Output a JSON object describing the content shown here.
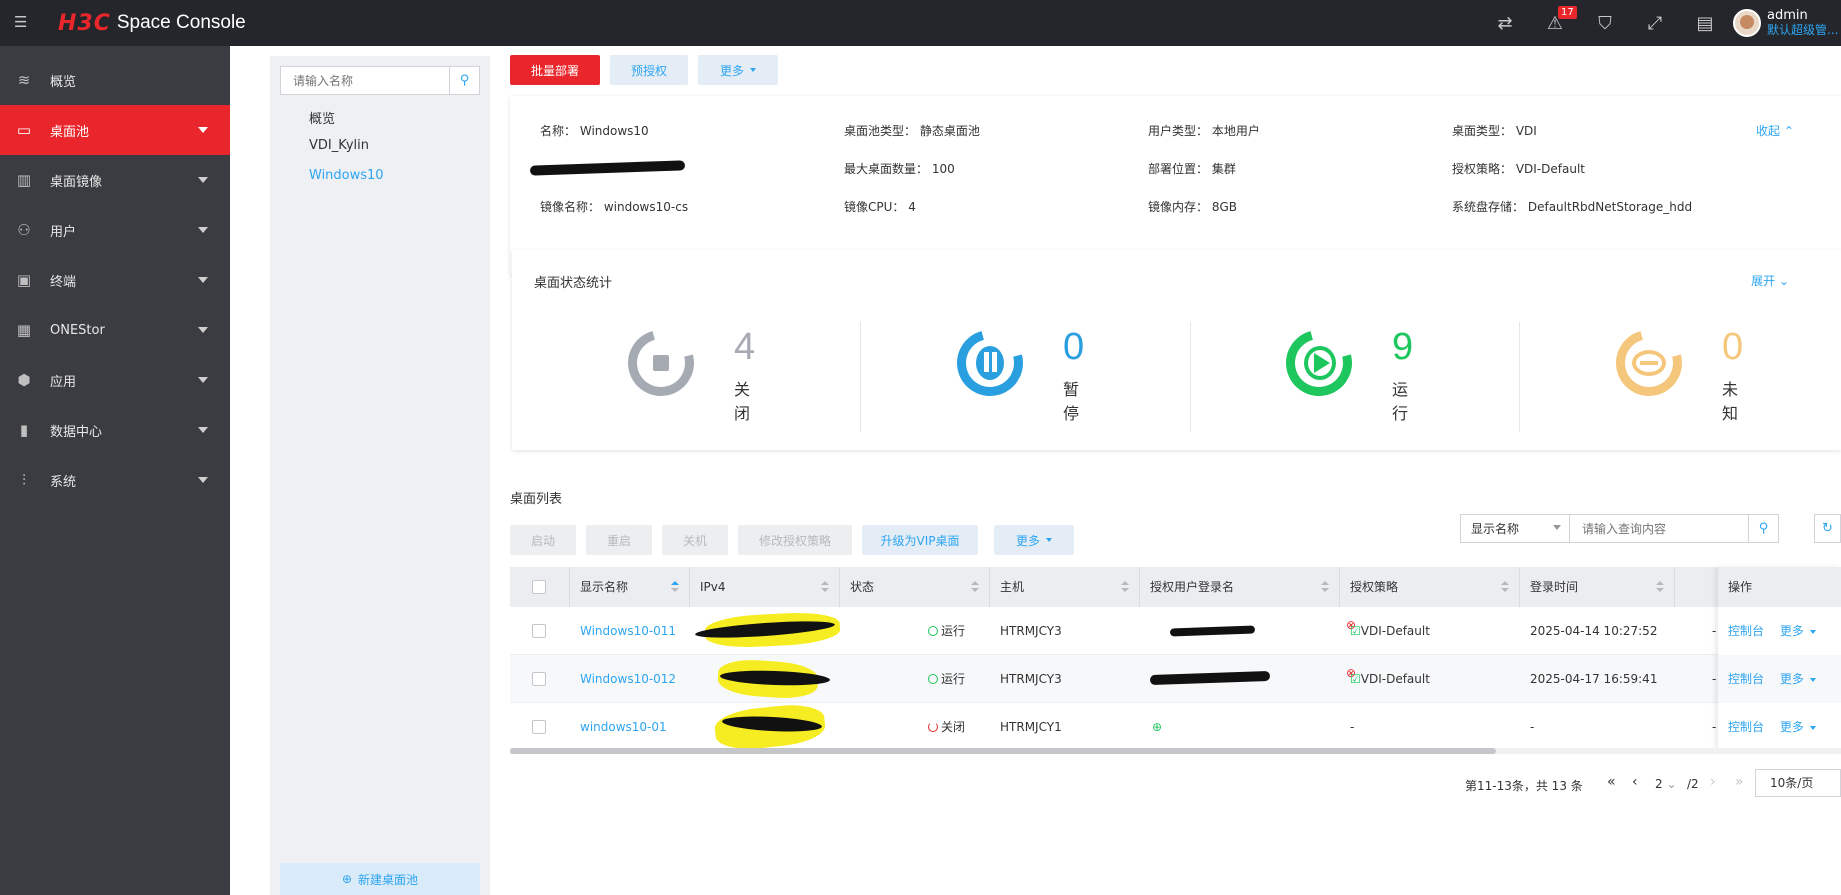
{
  "header": {
    "brand": "H3C",
    "product": "Space Console",
    "alert_count": "17",
    "user_name": "admin",
    "user_role": "默认超级管..."
  },
  "sidebar": {
    "items": [
      {
        "label": "概览",
        "icon": "layers-icon",
        "active": false,
        "caret": false
      },
      {
        "label": "桌面池",
        "icon": "desktop-pool-icon",
        "active": true,
        "caret": true
      },
      {
        "label": "桌面镜像",
        "icon": "image-icon",
        "active": false,
        "caret": true
      },
      {
        "label": "用户",
        "icon": "user-icon",
        "active": false,
        "caret": true
      },
      {
        "label": "终端",
        "icon": "terminal-icon",
        "active": false,
        "caret": true
      },
      {
        "label": "ONEStor",
        "icon": "storage-icon",
        "active": false,
        "caret": true
      },
      {
        "label": "应用",
        "icon": "cube-icon",
        "active": false,
        "caret": true
      },
      {
        "label": "数据中心",
        "icon": "datacenter-icon",
        "active": false,
        "caret": true
      },
      {
        "label": "系统",
        "icon": "settings-sliders-icon",
        "active": false,
        "caret": true
      }
    ]
  },
  "tree": {
    "search_placeholder": "请输入名称",
    "items": [
      "概览",
      "VDI_Kylin",
      "Windows10"
    ],
    "selected": "Windows10",
    "new_pool": "新建桌面池"
  },
  "toolbar": {
    "batch_deploy": "批量部署",
    "pre_authorize": "预授权",
    "more": "更多"
  },
  "info": {
    "name_label": "名称：",
    "name_value": "Windows10",
    "pool_type_label": "桌面池类型：",
    "pool_type_value": "静态桌面池",
    "user_type_label": "用户类型：",
    "user_type_value": "本地用户",
    "desktop_type_label": "桌面类型：",
    "desktop_type_value": "VDI",
    "collapse": "收起",
    "max_label": "最大桌面数量：",
    "max_value": "100",
    "deploy_label": "部署位置：",
    "deploy_value": "集群",
    "auth_policy_label": "授权策略：",
    "auth_policy_value": "VDI-Default",
    "image_name_label": "镜像名称：",
    "image_name_value": "windows10-cs",
    "image_cpu_label": "镜像CPU：",
    "image_cpu_value": "4",
    "image_mem_label": "镜像内存：",
    "image_mem_value": "8GB",
    "sys_disk_label": "系统盘存储：",
    "sys_disk_value": "DefaultRbdNetStorage_hdd"
  },
  "stats": {
    "title": "桌面状态统计",
    "expand": "展开",
    "items": [
      {
        "count": "4",
        "label": "关闭",
        "color": "#a6abb3"
      },
      {
        "count": "0",
        "label": "暂停",
        "color": "#2a9fe0"
      },
      {
        "count": "9",
        "label": "运行",
        "color": "#1ec65e"
      },
      {
        "count": "0",
        "label": "未知",
        "color": "#f5c77c"
      }
    ]
  },
  "list": {
    "title": "桌面列表",
    "actions": {
      "start": "启动",
      "restart": "重启",
      "shutdown": "关机",
      "modify_auth": "修改授权策略",
      "upgrade_vip": "升级为VIP桌面",
      "more": "更多"
    },
    "filter_select": "显示名称",
    "query_placeholder": "请输入查询内容",
    "columns": [
      "显示名称",
      "IPv4",
      "状态",
      "主机",
      "授权用户登录名",
      "授权策略",
      "登录时间",
      "操作"
    ],
    "rows": [
      {
        "name": "Windows10-011",
        "status": "运行",
        "host": "HTRMJCY3",
        "policy": "VDI-Default",
        "login_time": "2025-04-14 10:27:52",
        "trail": "-",
        "op_console": "控制台",
        "op_more": "更多"
      },
      {
        "name": "Windows10-012",
        "status": "运行",
        "host": "HTRMJCY3",
        "policy": "VDI-Default",
        "login_time": "2025-04-17 16:59:41",
        "trail": "-",
        "op_console": "控制台",
        "op_more": "更多"
      },
      {
        "name": "windows10-01",
        "status": "关闭",
        "host": "HTRMJCY1",
        "policy": "-",
        "login_time": "-",
        "trail": "-",
        "op_console": "控制台",
        "op_more": "更多"
      }
    ]
  },
  "pager": {
    "summary": "第11-13条，共 13 条",
    "current": "2",
    "total": "/2",
    "page_size": "10条/页"
  }
}
